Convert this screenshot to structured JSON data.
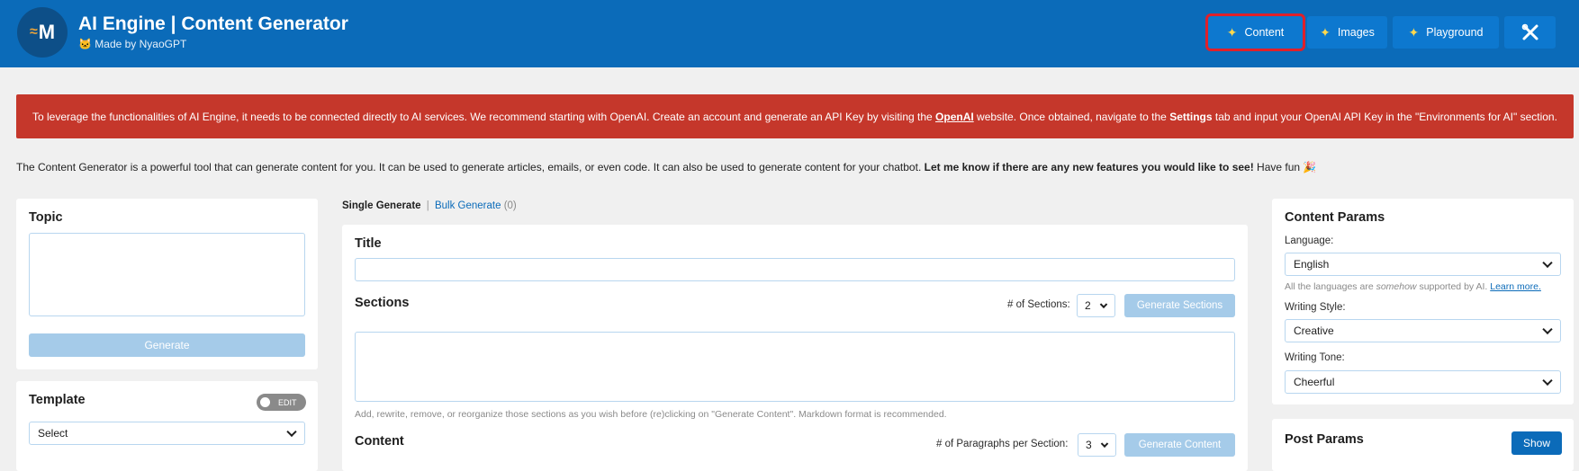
{
  "header": {
    "logo_text": "M",
    "title": "AI Engine | Content Generator",
    "subtitle": "🐱 Made by NyaoGPT",
    "nav": {
      "content": "Content",
      "images": "Images",
      "playground": "Playground",
      "tools_icon": "tools-icon"
    }
  },
  "alert": {
    "text_before": "To leverage the functionalities of AI Engine, it needs to be connected directly to AI services. We recommend starting with OpenAI. Create an account and generate an API Key by visiting the ",
    "link": "OpenAI",
    "text_middle": " website. Once obtained, navigate to the ",
    "bold": "Settings",
    "text_after": " tab and input your OpenAI API Key in the \"Environments for AI\" section."
  },
  "intro": {
    "text": "The Content Generator is a powerful tool that can generate content for you. It can be used to generate articles, emails, or even code. It can also be used to generate content for your chatbot. ",
    "bold": "Let me know if there are any new features you would like to see!",
    "after": " Have fun 🎉"
  },
  "topic": {
    "title": "Topic",
    "value": "",
    "generate": "Generate"
  },
  "template": {
    "title": "Template",
    "toggle": "EDIT",
    "select": "Select"
  },
  "tabs": {
    "single": "Single Generate",
    "separator": "|",
    "bulk": "Bulk Generate",
    "bulk_count": "(0)"
  },
  "main": {
    "title_label": "Title",
    "title_value": "",
    "sections_label": "Sections",
    "sections_count_label": "# of Sections:",
    "sections_count": "2",
    "generate_sections": "Generate Sections",
    "sections_hint": "Add, rewrite, remove, or reorganize those sections as you wish before (re)clicking on \"Generate Content\". Markdown format is recommended.",
    "content_label": "Content",
    "paragraphs_label": "# of Paragraphs per Section:",
    "paragraphs_count": "3",
    "generate_content": "Generate Content"
  },
  "content_params": {
    "title": "Content Params",
    "language_label": "Language:",
    "language": "English",
    "language_hint_before": "All the languages are ",
    "language_hint_em": "somehow",
    "language_hint_after": " supported by AI. ",
    "learn_more": "Learn more.",
    "style_label": "Writing Style:",
    "style": "Creative",
    "tone_label": "Writing Tone:",
    "tone": "Cheerful"
  },
  "post_params": {
    "title": "Post Params",
    "show": "Show"
  },
  "colors": {
    "header_bg": "#0b6bb9",
    "alert_bg": "#c5372b",
    "highlight": "#e0202a",
    "disabled_btn": "#a5cbe9"
  }
}
